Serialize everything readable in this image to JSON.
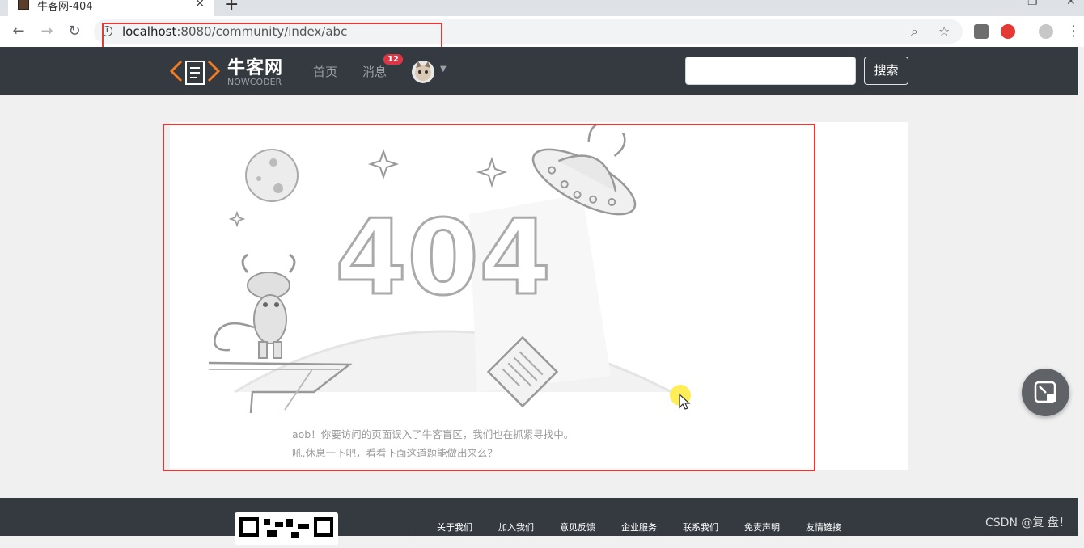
{
  "browser": {
    "tab_title": "牛客网-404",
    "tab_close": "×",
    "new_tab": "+",
    "url_host": "localhost",
    "url_rest": ":8080/community/index/abc"
  },
  "header": {
    "logo_text": "牛客网",
    "logo_sub": "NOWCODER",
    "nav": [
      {
        "label": "首页"
      },
      {
        "label": "消息"
      }
    ],
    "message_badge": "12",
    "search_placeholder": "",
    "search_button": "搜索"
  },
  "main": {
    "error_code": "404",
    "message_line1": "aob！你要访问的页面误入了牛客盲区，我们也在抓紧寻找中。",
    "message_line2": "吼,休息一下吧，看看下面这道题能做出来么？"
  },
  "footer": {
    "links": [
      "关于我们",
      "加入我们",
      "意见反馈",
      "企业服务",
      "联系我们",
      "免责声明",
      "友情链接"
    ]
  },
  "watermark": "CSDN @复 盘！",
  "colors": {
    "header_bg": "#343a40",
    "badge": "#dc3545",
    "highlight": "#e53935"
  }
}
